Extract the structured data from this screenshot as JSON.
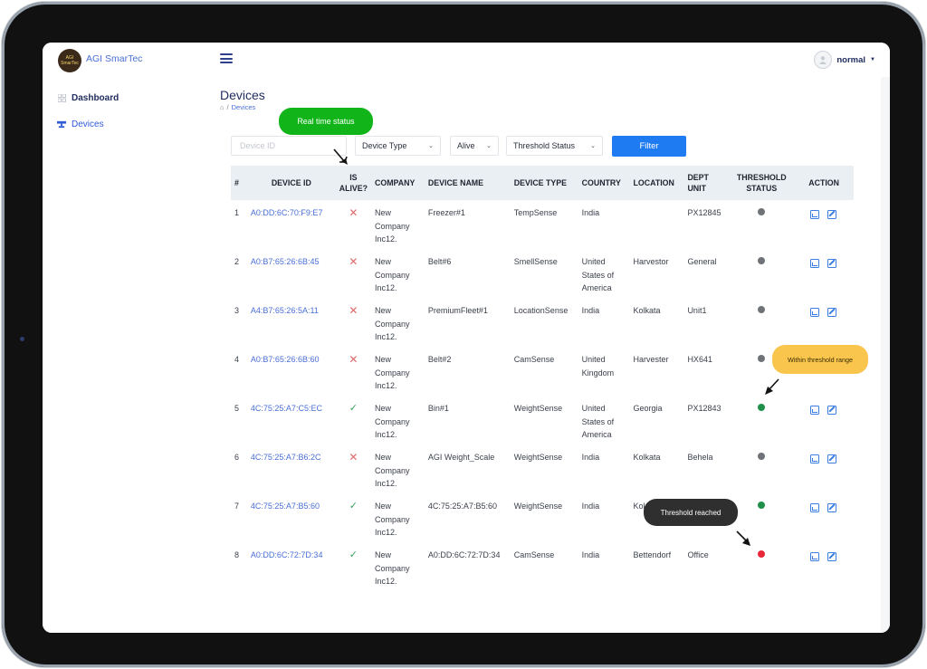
{
  "brand": {
    "name": "AGI SmarTec",
    "logo_text": "AGI SmarTec"
  },
  "sidebar": {
    "items": [
      {
        "label": "Dashboard",
        "icon": "grid-icon"
      },
      {
        "label": "Devices",
        "icon": "router-icon"
      }
    ]
  },
  "user": {
    "name": "normal"
  },
  "page": {
    "title": "Devices",
    "breadcrumb_current": "Devices"
  },
  "filters": {
    "device_id_placeholder": "Device ID",
    "device_type": "Device Type",
    "alive": "Alive",
    "threshold": "Threshold Status",
    "filter_label": "Filter"
  },
  "table": {
    "headers": [
      "#",
      "DEVICE ID",
      "IS ALIVE?",
      "COMPANY",
      "DEVICE NAME",
      "DEVICE TYPE",
      "COUNTRY",
      "LOCATION",
      "DEPT UNIT",
      "THRESHOLD STATUS",
      "ACTION"
    ],
    "rows": [
      {
        "num": "1",
        "id": "A0:DD:6C:70:F9:E7",
        "alive": false,
        "company": "New Company Inc12.",
        "name": "Freezer#1",
        "type": "TempSense",
        "country": "India",
        "location": "",
        "dept": "PX12845",
        "status": "grey"
      },
      {
        "num": "2",
        "id": "A0:B7:65:26:6B:45",
        "alive": false,
        "company": "New Company Inc12.",
        "name": "Belt#6",
        "type": "SmellSense",
        "country": "United States of America",
        "location": "Harvestor",
        "dept": "General",
        "status": "grey"
      },
      {
        "num": "3",
        "id": "A4:B7:65:26:5A:11",
        "alive": false,
        "company": "New Company Inc12.",
        "name": "PremiumFleet#1",
        "type": "LocationSense",
        "country": "India",
        "location": "Kolkata",
        "dept": "Unit1",
        "status": "grey"
      },
      {
        "num": "4",
        "id": "A0:B7:65:26:6B:60",
        "alive": false,
        "company": "New Company Inc12.",
        "name": "Belt#2",
        "type": "CamSense",
        "country": "United Kingdom",
        "location": "Harvester",
        "dept": "HX641",
        "status": "grey"
      },
      {
        "num": "5",
        "id": "4C:75:25:A7:C5:EC",
        "alive": true,
        "company": "New Company Inc12.",
        "name": "Bin#1",
        "type": "WeightSense",
        "country": "United States of America",
        "location": "Georgia",
        "dept": "PX12843",
        "status": "green"
      },
      {
        "num": "6",
        "id": "4C:75:25:A7:B6:2C",
        "alive": false,
        "company": "New Company Inc12.",
        "name": "AGI Weight_Scale",
        "type": "WeightSense",
        "country": "India",
        "location": "Kolkata",
        "dept": "Behela",
        "status": "grey"
      },
      {
        "num": "7",
        "id": "4C:75:25:A7:B5:60",
        "alive": true,
        "company": "New Company Inc12.",
        "name": "4C:75:25:A7:B5:60",
        "type": "WeightSense",
        "country": "India",
        "location": "Kol",
        "dept": "",
        "status": "green"
      },
      {
        "num": "8",
        "id": "A0:DD:6C:72:7D:34",
        "alive": true,
        "company": "New Company Inc12.",
        "name": "A0:DD:6C:72:7D:34",
        "type": "CamSense",
        "country": "India",
        "location": "Bettendorf",
        "dept": "Office",
        "status": "red"
      }
    ]
  },
  "annotations": {
    "realtime": "Real time status",
    "within": "Within threshold range",
    "reached": "Threshold reached"
  },
  "colors": {
    "grey": "#6f7378",
    "green": "#1f8f4a",
    "red": "#e8283a",
    "accent": "#1e7bf2"
  }
}
